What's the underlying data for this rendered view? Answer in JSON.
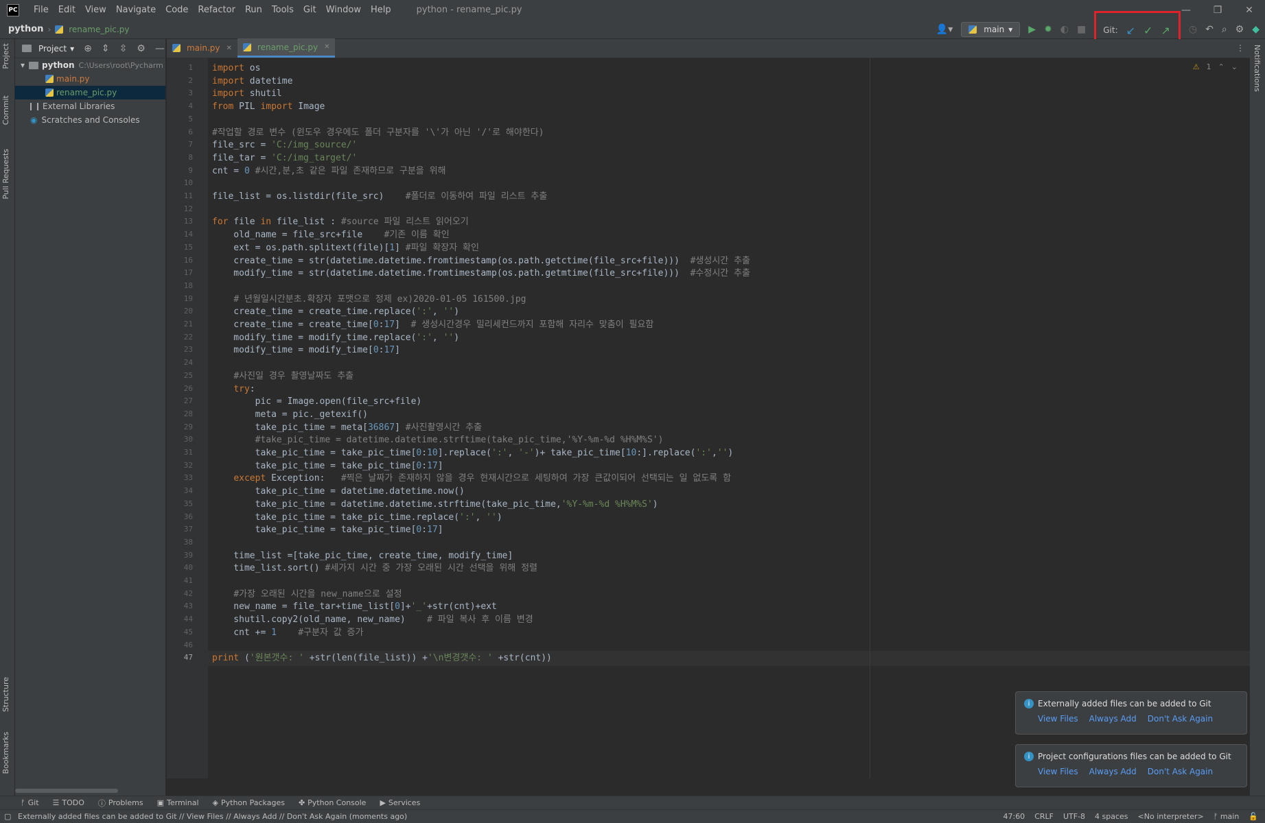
{
  "app": {
    "window_title": "python - rename_pic.py",
    "logo": "PC"
  },
  "menu": [
    "File",
    "Edit",
    "View",
    "Navigate",
    "Code",
    "Refactor",
    "Run",
    "Tools",
    "Git",
    "Window",
    "Help"
  ],
  "nav": {
    "project": "python",
    "file": "rename_pic.py"
  },
  "toolbar": {
    "branch": "main",
    "git_label": "Git:"
  },
  "project_panel": {
    "title": "Project",
    "root": {
      "name": "python",
      "path": "C:\\Users\\root\\Pycharm"
    },
    "files": [
      "main.py",
      "rename_pic.py"
    ],
    "external": "External Libraries",
    "scratches": "Scratches and Consoles"
  },
  "tabs": [
    {
      "label": "main.py",
      "active": false
    },
    {
      "label": "rename_pic.py",
      "active": true
    }
  ],
  "editor": {
    "warning_count": "1",
    "current_line": 47,
    "lines": [
      "import os",
      "import datetime",
      "import shutil",
      "from PIL import Image",
      "",
      "#작업할 경로 변수 (윈도우 경우에도 폴더 구분자를 '\\'가 아닌 '/'로 해야한다)",
      "file_src = 'C:/img_source/'",
      "file_tar = 'C:/img_target/'",
      "cnt = 0 #시간,분,초 같은 파일 존재하므로 구분을 위해",
      "",
      "file_list = os.listdir(file_src)    #폴더로 이동하여 파일 리스트 추출",
      "",
      "for file in file_list : #source 파일 리스트 읽어오기",
      "    old_name = file_src+file    #기존 이름 확인",
      "    ext = os.path.splitext(file)[1] #파일 확장자 확인",
      "    create_time = str(datetime.datetime.fromtimestamp(os.path.getctime(file_src+file)))  #생성시간 추출",
      "    modify_time = str(datetime.datetime.fromtimestamp(os.path.getmtime(file_src+file)))  #수정시간 추출",
      "",
      "    # 년월일시간분초.확장자 포맷으로 정제 ex)2020-01-05 161500.jpg",
      "    create_time = create_time.replace(':', '')",
      "    create_time = create_time[0:17]  # 생성시간경우 밀리세컨드까지 포함해 자리수 맞춤이 필요함",
      "    modify_time = modify_time.replace(':', '')",
      "    modify_time = modify_time[0:17]",
      "",
      "    #사진일 경우 촬영날짜도 추출",
      "    try:",
      "        pic = Image.open(file_src+file)",
      "        meta = pic._getexif()",
      "        take_pic_time = meta[36867] #사진촬영시간 추출",
      "        #take_pic_time = datetime.datetime.strftime(take_pic_time,'%Y-%m-%d %H%M%S')",
      "        take_pic_time = take_pic_time[0:10].replace(':', '-')+ take_pic_time[10:].replace(':','')",
      "        take_pic_time = take_pic_time[0:17]",
      "    except Exception:   #찍은 날짜가 존재하지 않을 경우 현재시간으로 세팅하여 가장 큰값이되어 선택되는 일 없도록 함",
      "        take_pic_time = datetime.datetime.now()",
      "        take_pic_time = datetime.datetime.strftime(take_pic_time,'%Y-%m-%d %H%M%S')",
      "        take_pic_time = take_pic_time.replace(':', '')",
      "        take_pic_time = take_pic_time[0:17]",
      "",
      "    time_list =[take_pic_time, create_time, modify_time]",
      "    time_list.sort() #세가지 시간 중 가장 오래된 시간 선택을 위해 정렬",
      "",
      "    #가장 오래된 시간을 new_name으로 설정",
      "    new_name = file_tar+time_list[0]+'_'+str(cnt)+ext",
      "    shutil.copy2(old_name, new_name)    # 파일 복사 후 이름 변경",
      "    cnt += 1    #구분자 값 증가",
      "",
      "print ('원본갯수: ' +str(len(file_list)) +'\\n변경갯수: ' +str(cnt))"
    ]
  },
  "notifications": [
    {
      "text": "Externally added files can be added to Git",
      "actions": [
        "View Files",
        "Always Add",
        "Don't Ask Again"
      ]
    },
    {
      "text": "Project configurations files can be added to Git",
      "actions": [
        "View Files",
        "Always Add",
        "Don't Ask Again"
      ]
    }
  ],
  "bottom_tabs": [
    "Git",
    "TODO",
    "Problems",
    "Terminal",
    "Python Packages",
    "Python Console",
    "Services"
  ],
  "left_tabs": [
    "Project",
    "Commit",
    "Pull Requests",
    "Structure",
    "Bookmarks"
  ],
  "right_tabs": [
    "Notifications"
  ],
  "status": {
    "message": "Externally added files can be added to Git // View Files // Always Add // Don't Ask Again (moments ago)",
    "position": "47:60",
    "line_sep": "CRLF",
    "encoding": "UTF-8",
    "indent": "4 spaces",
    "interpreter": "<No interpreter>",
    "branch": "main"
  },
  "colors": {
    "keyword": "#cc7832",
    "string": "#6a8759",
    "number": "#6897bb",
    "comment": "#808080",
    "highlight_box": "#e0222a"
  }
}
